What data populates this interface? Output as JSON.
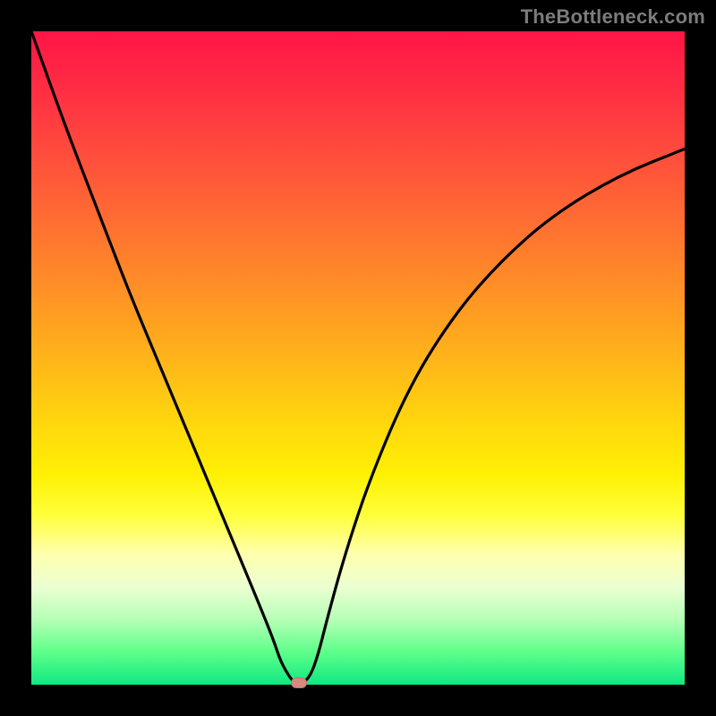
{
  "watermark": "TheBottleneck.com",
  "chart_data": {
    "type": "line",
    "title": "",
    "xlabel": "",
    "ylabel": "",
    "xlim": [
      0,
      100
    ],
    "ylim": [
      0,
      100
    ],
    "grid": false,
    "background_gradient": {
      "top_color": "#ff1546",
      "mid_color": "#fff104",
      "bottom_color": "#10e882"
    },
    "series": [
      {
        "name": "bottleneck-curve",
        "color": "#000000",
        "x": [
          0,
          5,
          10,
          15,
          20,
          25,
          30,
          35,
          37,
          38,
          39,
          40,
          41,
          42,
          43,
          44,
          45,
          48,
          52,
          58,
          65,
          72,
          80,
          90,
          100
        ],
        "values": [
          100,
          86,
          73,
          60,
          48,
          36,
          24,
          12,
          7,
          4,
          2,
          0.5,
          0.3,
          0.5,
          2,
          5,
          9,
          20,
          32,
          46,
          57,
          65,
          72,
          78,
          82
        ]
      }
    ],
    "marker": {
      "name": "optimal-point",
      "x": 41,
      "y": 0.3,
      "color": "#d78a82"
    }
  }
}
